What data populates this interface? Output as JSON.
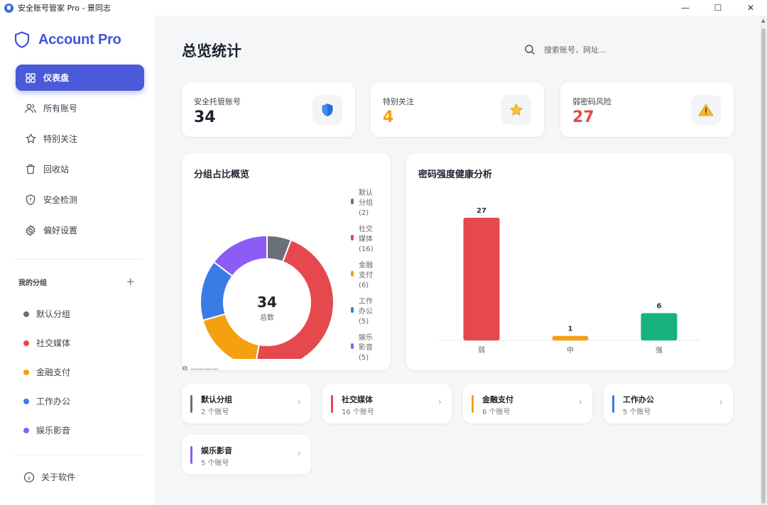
{
  "window": {
    "title": "安全账号管家 Pro - 景同志",
    "controls": [
      "—",
      "☐",
      "✕"
    ]
  },
  "brand": {
    "name": "Account Pro",
    "accent": "#4a5ad8"
  },
  "sidebar": {
    "nav": [
      {
        "label": "仪表盘",
        "icon": "grid-icon",
        "active": true
      },
      {
        "label": "所有账号",
        "icon": "users-icon"
      },
      {
        "label": "特别关注",
        "icon": "star-icon"
      },
      {
        "label": "回收站",
        "icon": "trash-icon"
      },
      {
        "label": "安全检测",
        "icon": "shield-alert-icon"
      },
      {
        "label": "偏好设置",
        "icon": "settings-icon"
      }
    ],
    "groups_title": "我的分组",
    "add_symbol": "+",
    "groups": [
      {
        "label": "默认分组",
        "color": "#6b6f7b"
      },
      {
        "label": "社交媒体",
        "color": "#e5484d"
      },
      {
        "label": "金融支付",
        "color": "#f5a00f"
      },
      {
        "label": "工作办公",
        "color": "#3b7be6"
      },
      {
        "label": "娱乐影音",
        "color": "#8b5cf6"
      }
    ],
    "about": "关于软件"
  },
  "main": {
    "title": "总览统计",
    "search_placeholder": "搜索账号、网址..."
  },
  "stats": [
    {
      "label": "安全托管账号",
      "value": "34",
      "color": "#1f2430",
      "icon": "shield-icon"
    },
    {
      "label": "特别关注",
      "value": "4",
      "color": "#f5a00f",
      "icon": "star-icon"
    },
    {
      "label": "弱密码风险",
      "value": "27",
      "color": "#e5484d",
      "icon": "warning-icon"
    }
  ],
  "donut": {
    "title": "分组占比概览",
    "total": "34",
    "total_label": "总数"
  },
  "bars": {
    "title": "密码强度健康分析"
  },
  "chart_data": [
    {
      "type": "pie",
      "title": "分组占比概览",
      "categories": [
        "默认分组",
        "社交媒体",
        "金融支付",
        "工作办公",
        "娱乐影音"
      ],
      "values": [
        2,
        16,
        6,
        5,
        5
      ],
      "colors": [
        "#6b6f7b",
        "#e5484d",
        "#f5a00f",
        "#3b7be6",
        "#8b5cf6"
      ],
      "legend": "right"
    },
    {
      "type": "bar",
      "title": "密码强度健康分析",
      "categories": [
        "弱",
        "中",
        "强"
      ],
      "values": [
        27,
        1,
        6
      ],
      "colors": [
        "#e5484d",
        "#f5a00f",
        "#17b27f"
      ],
      "ylim": [
        0,
        27
      ]
    }
  ],
  "group_cards": [
    {
      "name": "默认分组",
      "sub": "2 个账号",
      "color": "#6b6f7b"
    },
    {
      "name": "社交媒体",
      "sub": "16 个账号",
      "color": "#e5484d"
    },
    {
      "name": "金融支付",
      "sub": "6 个账号",
      "color": "#f5a00f"
    },
    {
      "name": "工作办公",
      "sub": "5 个账号",
      "color": "#3b7be6"
    },
    {
      "name": "娱乐影音",
      "sub": "5 个账号",
      "color": "#8b5cf6"
    }
  ],
  "chevron": "›"
}
